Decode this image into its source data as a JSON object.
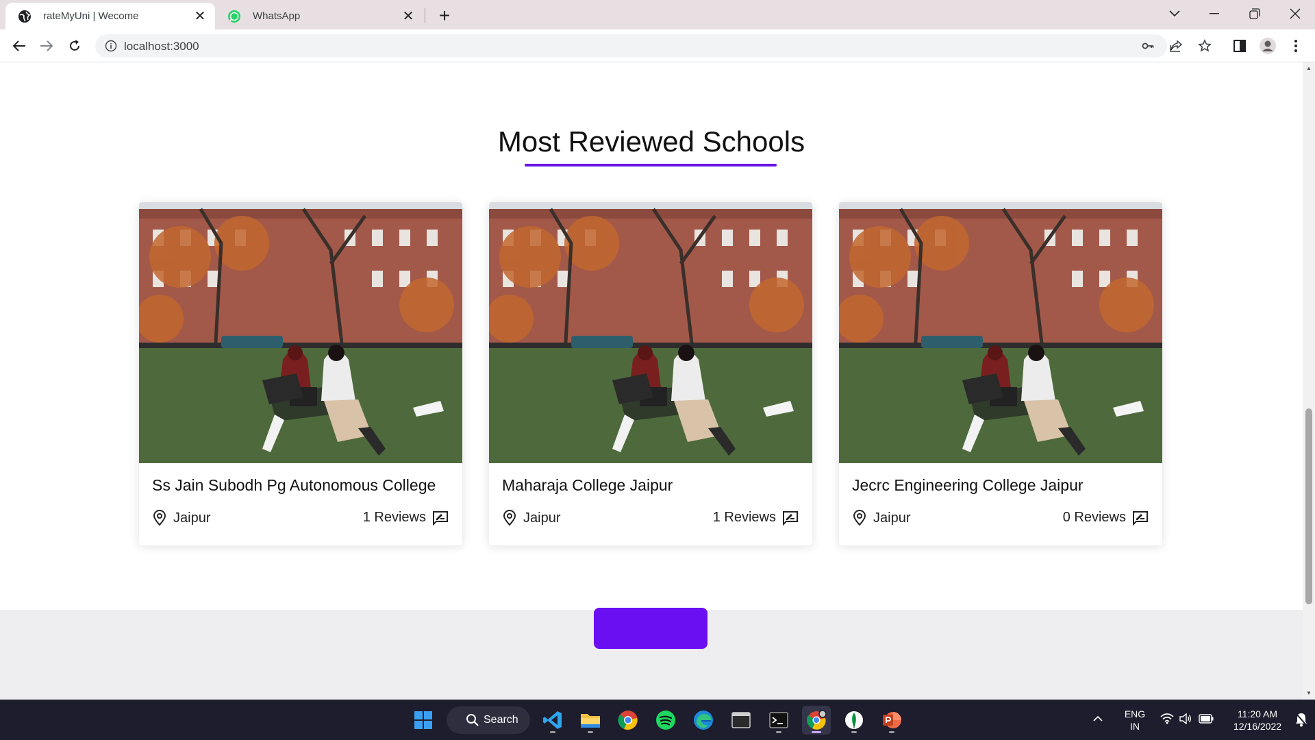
{
  "browser": {
    "tabs": [
      {
        "title": "rateMyUni | Wecome",
        "active": true,
        "favicon": "globe-icon"
      },
      {
        "title": "WhatsApp",
        "active": false,
        "favicon": "whatsapp-icon"
      }
    ],
    "url": "localhost:3000"
  },
  "page": {
    "section_title": "Most Reviewed Schools",
    "accent_color": "#6a11e6",
    "schools": [
      {
        "name": "Ss Jain Subodh Pg Autonomous College",
        "location": "Jaipur",
        "reviews": "1 Reviews"
      },
      {
        "name": "Maharaja College Jaipur",
        "location": "Jaipur",
        "reviews": "1 Reviews"
      },
      {
        "name": "Jecrc Engineering College Jaipur",
        "location": "Jaipur",
        "reviews": "0 Reviews"
      }
    ],
    "footer_button_color": "#6a0ff2"
  },
  "taskbar": {
    "search_label": "Search",
    "language_line1": "ENG",
    "language_line2": "IN",
    "time": "11:20 AM",
    "date": "12/16/2022"
  }
}
